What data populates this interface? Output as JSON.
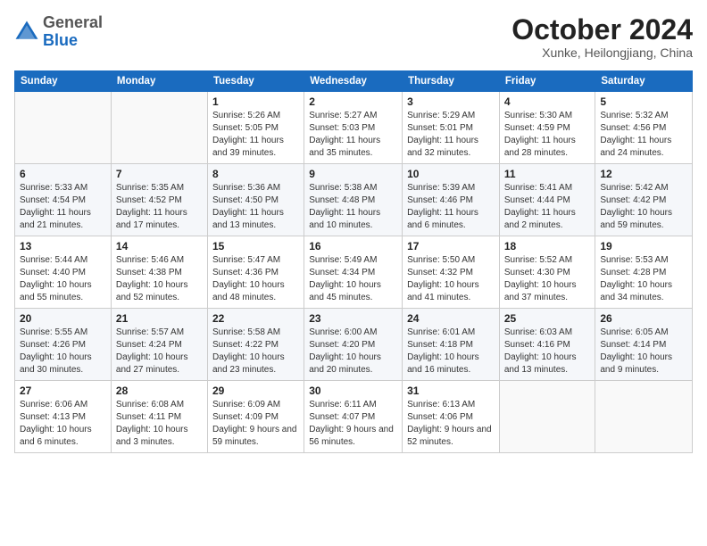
{
  "logo": {
    "general": "General",
    "blue": "Blue"
  },
  "title": "October 2024",
  "subtitle": "Xunke, Heilongjiang, China",
  "days_of_week": [
    "Sunday",
    "Monday",
    "Tuesday",
    "Wednesday",
    "Thursday",
    "Friday",
    "Saturday"
  ],
  "weeks": [
    [
      {
        "day": "",
        "info": ""
      },
      {
        "day": "",
        "info": ""
      },
      {
        "day": "1",
        "info": "Sunrise: 5:26 AM\nSunset: 5:05 PM\nDaylight: 11 hours and 39 minutes."
      },
      {
        "day": "2",
        "info": "Sunrise: 5:27 AM\nSunset: 5:03 PM\nDaylight: 11 hours and 35 minutes."
      },
      {
        "day": "3",
        "info": "Sunrise: 5:29 AM\nSunset: 5:01 PM\nDaylight: 11 hours and 32 minutes."
      },
      {
        "day": "4",
        "info": "Sunrise: 5:30 AM\nSunset: 4:59 PM\nDaylight: 11 hours and 28 minutes."
      },
      {
        "day": "5",
        "info": "Sunrise: 5:32 AM\nSunset: 4:56 PM\nDaylight: 11 hours and 24 minutes."
      }
    ],
    [
      {
        "day": "6",
        "info": "Sunrise: 5:33 AM\nSunset: 4:54 PM\nDaylight: 11 hours and 21 minutes."
      },
      {
        "day": "7",
        "info": "Sunrise: 5:35 AM\nSunset: 4:52 PM\nDaylight: 11 hours and 17 minutes."
      },
      {
        "day": "8",
        "info": "Sunrise: 5:36 AM\nSunset: 4:50 PM\nDaylight: 11 hours and 13 minutes."
      },
      {
        "day": "9",
        "info": "Sunrise: 5:38 AM\nSunset: 4:48 PM\nDaylight: 11 hours and 10 minutes."
      },
      {
        "day": "10",
        "info": "Sunrise: 5:39 AM\nSunset: 4:46 PM\nDaylight: 11 hours and 6 minutes."
      },
      {
        "day": "11",
        "info": "Sunrise: 5:41 AM\nSunset: 4:44 PM\nDaylight: 11 hours and 2 minutes."
      },
      {
        "day": "12",
        "info": "Sunrise: 5:42 AM\nSunset: 4:42 PM\nDaylight: 10 hours and 59 minutes."
      }
    ],
    [
      {
        "day": "13",
        "info": "Sunrise: 5:44 AM\nSunset: 4:40 PM\nDaylight: 10 hours and 55 minutes."
      },
      {
        "day": "14",
        "info": "Sunrise: 5:46 AM\nSunset: 4:38 PM\nDaylight: 10 hours and 52 minutes."
      },
      {
        "day": "15",
        "info": "Sunrise: 5:47 AM\nSunset: 4:36 PM\nDaylight: 10 hours and 48 minutes."
      },
      {
        "day": "16",
        "info": "Sunrise: 5:49 AM\nSunset: 4:34 PM\nDaylight: 10 hours and 45 minutes."
      },
      {
        "day": "17",
        "info": "Sunrise: 5:50 AM\nSunset: 4:32 PM\nDaylight: 10 hours and 41 minutes."
      },
      {
        "day": "18",
        "info": "Sunrise: 5:52 AM\nSunset: 4:30 PM\nDaylight: 10 hours and 37 minutes."
      },
      {
        "day": "19",
        "info": "Sunrise: 5:53 AM\nSunset: 4:28 PM\nDaylight: 10 hours and 34 minutes."
      }
    ],
    [
      {
        "day": "20",
        "info": "Sunrise: 5:55 AM\nSunset: 4:26 PM\nDaylight: 10 hours and 30 minutes."
      },
      {
        "day": "21",
        "info": "Sunrise: 5:57 AM\nSunset: 4:24 PM\nDaylight: 10 hours and 27 minutes."
      },
      {
        "day": "22",
        "info": "Sunrise: 5:58 AM\nSunset: 4:22 PM\nDaylight: 10 hours and 23 minutes."
      },
      {
        "day": "23",
        "info": "Sunrise: 6:00 AM\nSunset: 4:20 PM\nDaylight: 10 hours and 20 minutes."
      },
      {
        "day": "24",
        "info": "Sunrise: 6:01 AM\nSunset: 4:18 PM\nDaylight: 10 hours and 16 minutes."
      },
      {
        "day": "25",
        "info": "Sunrise: 6:03 AM\nSunset: 4:16 PM\nDaylight: 10 hours and 13 minutes."
      },
      {
        "day": "26",
        "info": "Sunrise: 6:05 AM\nSunset: 4:14 PM\nDaylight: 10 hours and 9 minutes."
      }
    ],
    [
      {
        "day": "27",
        "info": "Sunrise: 6:06 AM\nSunset: 4:13 PM\nDaylight: 10 hours and 6 minutes."
      },
      {
        "day": "28",
        "info": "Sunrise: 6:08 AM\nSunset: 4:11 PM\nDaylight: 10 hours and 3 minutes."
      },
      {
        "day": "29",
        "info": "Sunrise: 6:09 AM\nSunset: 4:09 PM\nDaylight: 9 hours and 59 minutes."
      },
      {
        "day": "30",
        "info": "Sunrise: 6:11 AM\nSunset: 4:07 PM\nDaylight: 9 hours and 56 minutes."
      },
      {
        "day": "31",
        "info": "Sunrise: 6:13 AM\nSunset: 4:06 PM\nDaylight: 9 hours and 52 minutes."
      },
      {
        "day": "",
        "info": ""
      },
      {
        "day": "",
        "info": ""
      }
    ]
  ]
}
